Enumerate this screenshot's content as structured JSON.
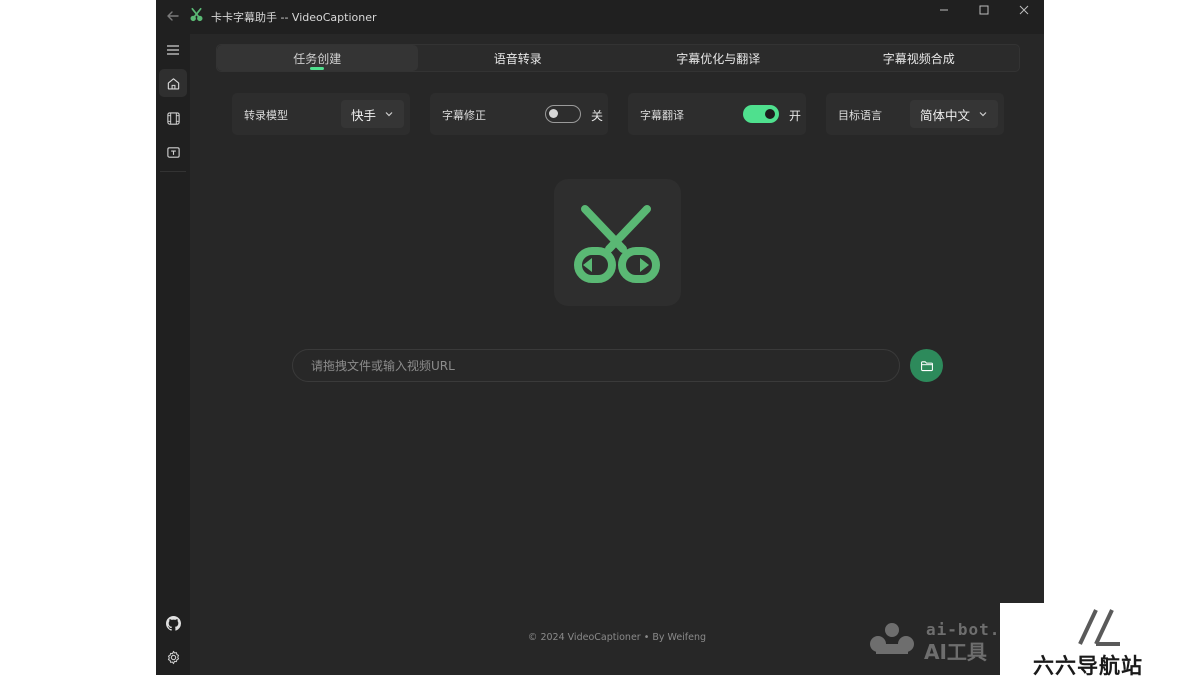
{
  "app": {
    "title": "卡卡字幕助手 -- VideoCaptioner"
  },
  "tabs": [
    {
      "label": "任务创建",
      "active": true
    },
    {
      "label": "语音转录",
      "active": false
    },
    {
      "label": "字幕优化与翻译",
      "active": false
    },
    {
      "label": "字幕视频合成",
      "active": false
    }
  ],
  "settings": {
    "model": {
      "label": "转录模型",
      "value": "快手"
    },
    "correction": {
      "label": "字幕修正",
      "state_text": "关",
      "enabled": false
    },
    "translation": {
      "label": "字幕翻译",
      "state_text": "开",
      "enabled": true
    },
    "target_language": {
      "label": "目标语言",
      "value": "简体中文"
    }
  },
  "input": {
    "placeholder": "请拖拽文件或输入视频URL",
    "value": ""
  },
  "footer": {
    "text": "© 2024 VideoCaptioner • By Weifeng"
  },
  "watermarks": {
    "left_line1": "ai-bot.",
    "left_line2": "AI工具",
    "right": "六六导航站"
  },
  "colors": {
    "accent": "#4fe08e",
    "logo_green": "#5ab874",
    "folder_button": "#2d8a5b",
    "background": "#272727"
  },
  "icons": {
    "back": "arrow-left-icon",
    "menu": "hamburger-icon",
    "home": "home-icon",
    "video": "film-icon",
    "subtitle": "text-box-icon",
    "github": "github-icon",
    "settings": "gear-icon",
    "folder": "folder-icon"
  }
}
